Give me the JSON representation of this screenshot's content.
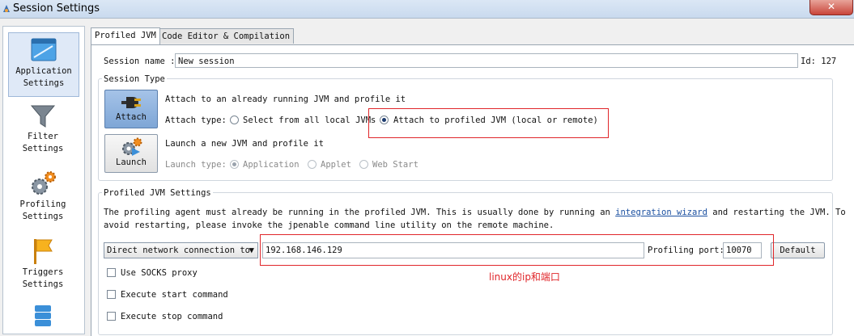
{
  "window": {
    "title": "Session Settings",
    "close_symbol": "✕"
  },
  "sidebar": {
    "items": [
      {
        "label": "Application\nSettings",
        "icon": "window-icon",
        "selected": true
      },
      {
        "label": "Filter\nSettings",
        "icon": "funnel-icon"
      },
      {
        "label": "Profiling\nSettings",
        "icon": "gears-icon"
      },
      {
        "label": "Triggers\nSettings",
        "icon": "flag-icon"
      },
      {
        "label": "",
        "icon": "database-icon"
      }
    ]
  },
  "tabs": [
    {
      "label": "Profiled JVM",
      "active": true
    },
    {
      "label": "Code Editor & Compilation",
      "active": false
    }
  ],
  "session": {
    "name_label": "Session name :",
    "name_value": "New session",
    "id_label": "Id: 127"
  },
  "session_type": {
    "legend": "Session Type",
    "attach": {
      "button_label": "Attach",
      "description": "Attach to an already running JVM and profile it",
      "type_label": "Attach type:",
      "options": [
        "Select from all local JVMs",
        "Attach to profiled JVM (local or remote)"
      ],
      "selected": 1
    },
    "launch": {
      "button_label": "Launch",
      "description": "Launch a new JVM and profile it",
      "type_label": "Launch type:",
      "options": [
        "Application",
        "Applet",
        "Web Start"
      ],
      "selected": 0
    }
  },
  "jvm_settings": {
    "legend": "Profiled JVM Settings",
    "text_line1_pre": "The profiling agent must already be running in the profiled JVM. This is usually done by running an ",
    "text_link": "integration wizard",
    "text_line1_post": " and restarting the JVM. To",
    "text_line2": "avoid restarting, please invoke the jpenable command line utility on the remote machine.",
    "connection_mode": "Direct network connection to",
    "host": "192.168.146.129",
    "port_label": "Profiling port:",
    "port": "10070",
    "default_button": "Default",
    "annotation": "linux的ip和端口",
    "checkboxes": [
      "Use SOCKS proxy",
      "Execute start command",
      "Execute stop command"
    ]
  },
  "colors": {
    "annotation_red": "#e0262a",
    "link_blue": "#1a4fa0",
    "selection_bg": "#dfe9f7"
  }
}
